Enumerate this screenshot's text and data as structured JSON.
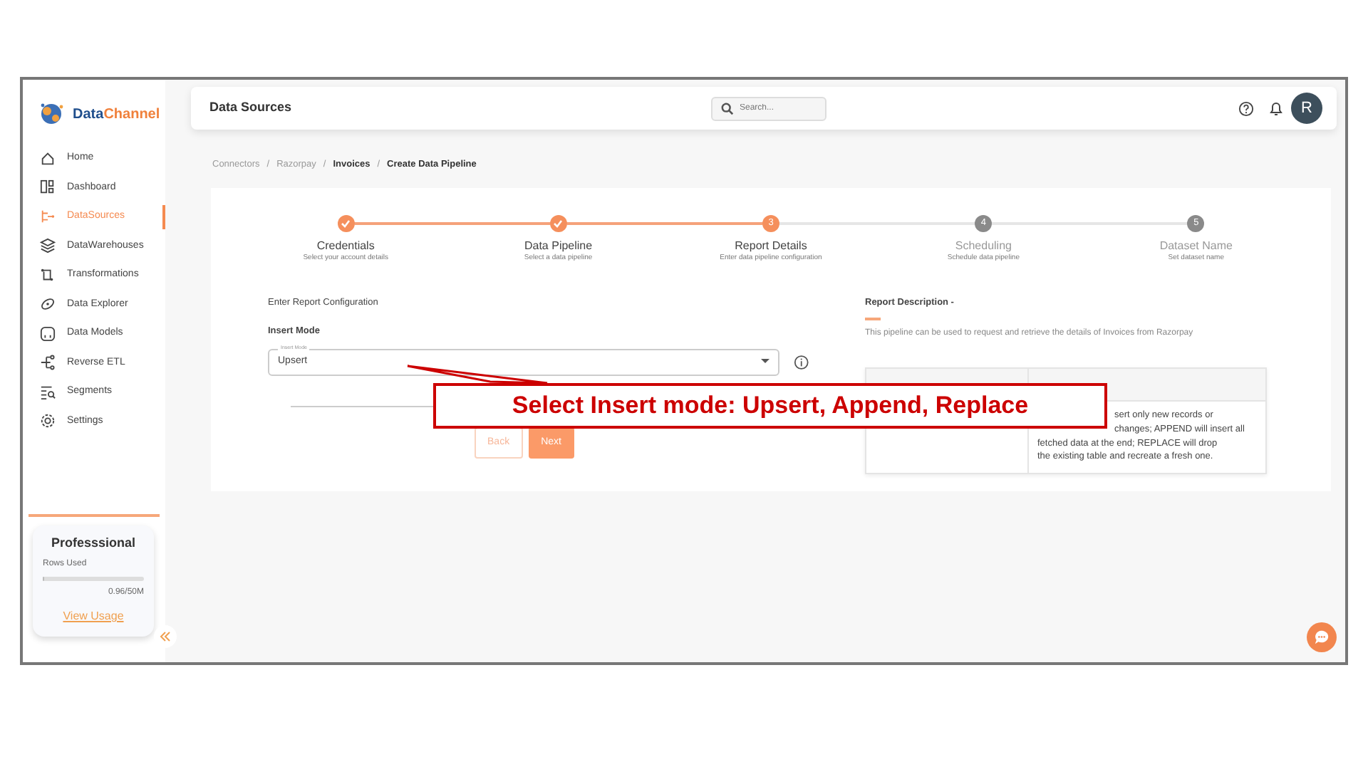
{
  "sidebar": {
    "logo": {
      "first": "Data",
      "second": "Channel"
    },
    "items": [
      {
        "label": "Home",
        "selected": false
      },
      {
        "label": "Dashboard",
        "selected": false
      },
      {
        "label": "DataSources",
        "selected": true
      },
      {
        "label": "DataWarehouses",
        "selected": false
      },
      {
        "label": "Transformations",
        "selected": false
      },
      {
        "label": "Data Explorer",
        "selected": false
      },
      {
        "label": "Data Models",
        "selected": false
      },
      {
        "label": "Reverse ETL",
        "selected": false
      },
      {
        "label": "Segments",
        "selected": false
      },
      {
        "label": "Settings",
        "selected": false
      }
    ],
    "plan": {
      "name": "Professsional",
      "rows_label": "Rows Used",
      "level": 0.02,
      "usage": "0.96/50M",
      "link": "View Usage"
    }
  },
  "header": {
    "title": "Data Sources",
    "search": {
      "placeholder": "Search..."
    },
    "avatar": "R"
  },
  "breadcrumb": [
    {
      "label": "Connectors",
      "muted": true
    },
    {
      "separator": "/",
      "label": "Razorpay",
      "muted": true
    },
    {
      "separator": "/",
      "label": "Invoices",
      "muted": false
    },
    {
      "separator": "/",
      "label": "Create Data Pipeline",
      "muted": false
    }
  ],
  "steps": [
    {
      "reached": true,
      "completed": true,
      "label": "Credentials",
      "hint": "Select your account details"
    },
    {
      "reached": true,
      "completed": true,
      "label": "Data Pipeline",
      "hint": "Select a data pipeline"
    },
    {
      "reached": true,
      "completed": false,
      "number": "3",
      "label": "Report Details",
      "hint": "Enter data pipeline configuration"
    },
    {
      "reached": false,
      "completed": false,
      "number": "4",
      "label": "Scheduling",
      "hint": "Schedule data pipeline"
    },
    {
      "reached": false,
      "completed": false,
      "number": "5",
      "label": "Dataset Name",
      "hint": "Set dataset name"
    }
  ],
  "form": {
    "section_title": "Enter Report Configuration",
    "field_label": "Insert Mode",
    "select": {
      "label": "Insert Mode",
      "value": "Upsert"
    },
    "buttons": [
      {
        "label": "Back",
        "kind": "outline"
      },
      {
        "label": "Next",
        "kind": "primary"
      }
    ]
  },
  "description": {
    "title": "Report Description -",
    "text": "This pipeline can be used to request and retrieve the details of Invoices from Razorpay",
    "table_lines": [
      "sert only new records or",
      "changes; APPEND will insert all",
      "fetched data at the end; REPLACE will drop",
      "the existing table and recreate a fresh one."
    ]
  },
  "annotation": {
    "text": "Select Insert mode: Upsert, Append, Replace"
  }
}
